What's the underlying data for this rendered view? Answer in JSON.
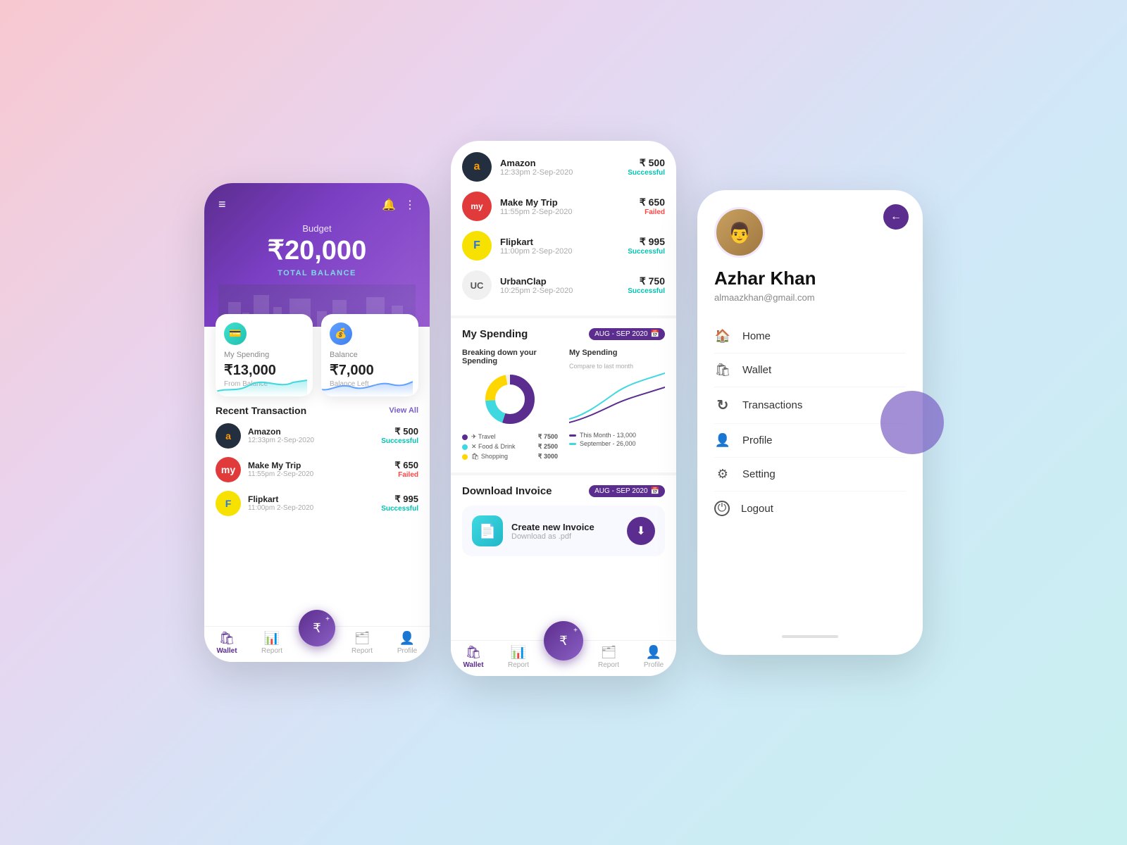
{
  "bg": {
    "gradient_start": "#f8c8d0",
    "gradient_end": "#c8f0f0"
  },
  "phone1": {
    "header": {
      "budget_label": "Budget",
      "budget_amount": "₹20,000",
      "total_balance": "TOTAL BALANCE"
    },
    "cards": [
      {
        "label": "My Spending",
        "amount": "₹13,000",
        "sublabel": "From Balance"
      },
      {
        "label": "Balance",
        "amount": "₹7,000",
        "sublabel": "Balance Left"
      }
    ],
    "recent_transaction_title": "Recent Transaction",
    "view_all": "View All",
    "transactions": [
      {
        "name": "Amazon",
        "date": "12:33pm 2-Sep-2020",
        "amount": "₹ 500",
        "status": "Successful",
        "status_type": "success",
        "logo": "a",
        "logo_class": "tx-amazon"
      },
      {
        "name": "Make My Trip",
        "date": "11:55pm 2-Sep-2020",
        "amount": "₹ 650",
        "status": "Failed",
        "status_type": "failed",
        "logo": "my",
        "logo_class": "tx-mmt"
      },
      {
        "name": "Flipkart",
        "date": "11:00pm 2-Sep-2020",
        "amount": "₹ 995",
        "status": "Successful",
        "status_type": "success",
        "logo": "F",
        "logo_class": "tx-flipkart"
      }
    ],
    "footer": [
      {
        "label": "Wallet",
        "active": true
      },
      {
        "label": "Report",
        "active": false
      },
      {
        "label": "",
        "active": false,
        "is_fab": false
      },
      {
        "label": "Report",
        "active": false
      },
      {
        "label": "Profile",
        "active": false
      }
    ]
  },
  "phone2": {
    "transactions_top": [
      {
        "name": "Amazon",
        "date": "12:33pm 2-Sep-2020",
        "amount": "₹ 500",
        "status": "Successful",
        "status_type": "success",
        "logo": "a",
        "logo_class": "tx-amazon"
      },
      {
        "name": "Make My Trip",
        "date": "11:55pm 2-Sep-2020",
        "amount": "₹ 650",
        "status": "Failed",
        "status_type": "failed",
        "logo": "my",
        "logo_class": "tx-mmt"
      },
      {
        "name": "Flipkart",
        "date": "11:00pm 2-Sep-2020",
        "amount": "₹ 995",
        "status": "Successful",
        "status_type": "success",
        "logo": "F",
        "logo_class": "tx-flipkart"
      },
      {
        "name": "UrbanClap",
        "date": "10:25pm 2-Sep-2020",
        "amount": "₹ 750",
        "status": "Successful",
        "status_type": "success",
        "logo": "UC",
        "logo_class": "tx-uc"
      }
    ],
    "spending": {
      "title": "My Spending",
      "date_badge": "AUG - SEP 2020",
      "breakdown_title": "Breaking down your Spending",
      "compare_title": "My Spending",
      "compare_subtitle": "Compare to last month",
      "donut": {
        "segments": [
          {
            "label": "Travel",
            "value": "₹ 7500",
            "color": "#5b2d8e",
            "percent": 55
          },
          {
            "label": "Food & Drink",
            "value": "₹ 2500",
            "color": "#40d8e0",
            "percent": 19
          },
          {
            "label": "Shopping",
            "value": "₹ 3000",
            "color": "#ffd700",
            "percent": 23
          }
        ]
      },
      "line_legend": [
        {
          "label": "This Month - 13,000",
          "color": "#5b2d8e"
        },
        {
          "label": "September - 26,000",
          "color": "#40d8e0"
        }
      ]
    },
    "invoice": {
      "title": "Download Invoice",
      "date_badge": "AUG - SEP 2020",
      "name": "Create new Invoice",
      "sub": "Download as .pdf"
    },
    "footer": [
      {
        "label": "Wallet",
        "active": true
      },
      {
        "label": "Report",
        "active": false
      },
      {
        "label": "",
        "active": false,
        "is_fab": true
      },
      {
        "label": "Report",
        "active": false
      },
      {
        "label": "Profile",
        "active": false
      }
    ]
  },
  "phone3": {
    "profile": {
      "name": "Azhar Khan",
      "email": "almaazkhan@gmail.com"
    },
    "menu": [
      {
        "label": "Home",
        "icon": "🏠"
      },
      {
        "label": "Wallet",
        "icon": "🛍"
      },
      {
        "label": "Transactions",
        "icon": "↻"
      },
      {
        "label": "Profile",
        "icon": "👤"
      },
      {
        "label": "Setting",
        "icon": "⚙"
      },
      {
        "label": "Logout",
        "icon": "⏻"
      }
    ]
  }
}
